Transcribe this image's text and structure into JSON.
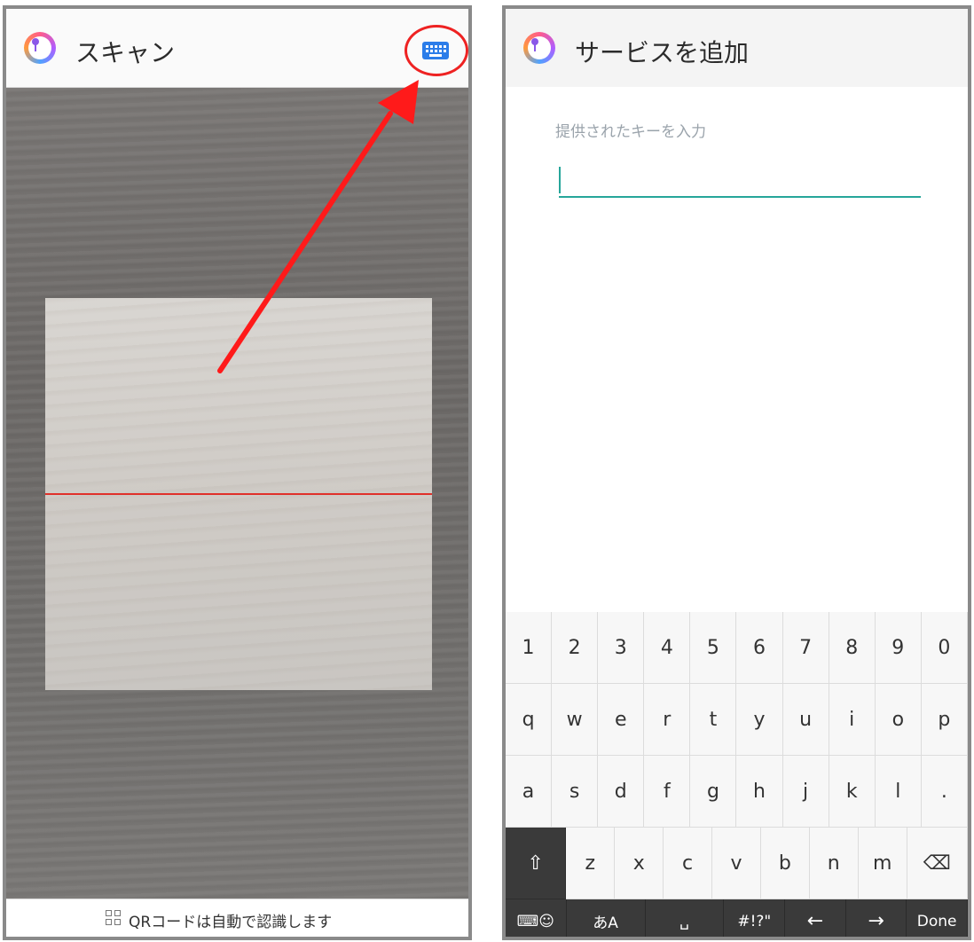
{
  "left_screen": {
    "title": "スキャン",
    "hint": "QRコードは自動で認識します"
  },
  "right_screen": {
    "title": "サービスを追加",
    "field_label": "提供されたキーを入力",
    "field_value": "",
    "keyboard": {
      "number_row": [
        "1",
        "2",
        "3",
        "4",
        "5",
        "6",
        "7",
        "8",
        "9",
        "0"
      ],
      "row1": [
        "q",
        "w",
        "e",
        "r",
        "t",
        "y",
        "u",
        "i",
        "o",
        "p"
      ],
      "row2": [
        "a",
        "s",
        "d",
        "f",
        "g",
        "h",
        "j",
        "k",
        "l",
        "."
      ],
      "row3": [
        "z",
        "x",
        "c",
        "v",
        "b",
        "n",
        "m"
      ],
      "shift": "⇧",
      "backspace": "⌫",
      "bottom_row": {
        "emoji": "⌨☺",
        "lang": "あA",
        "space": "␣",
        "symbols": "#!?\"",
        "left": "←",
        "right": "→",
        "done": "Done"
      }
    }
  },
  "colors": {
    "accent_teal": "#26a69a",
    "annotation_red": "#ee2222",
    "keyboard_icon_blue": "#2b7de9"
  }
}
